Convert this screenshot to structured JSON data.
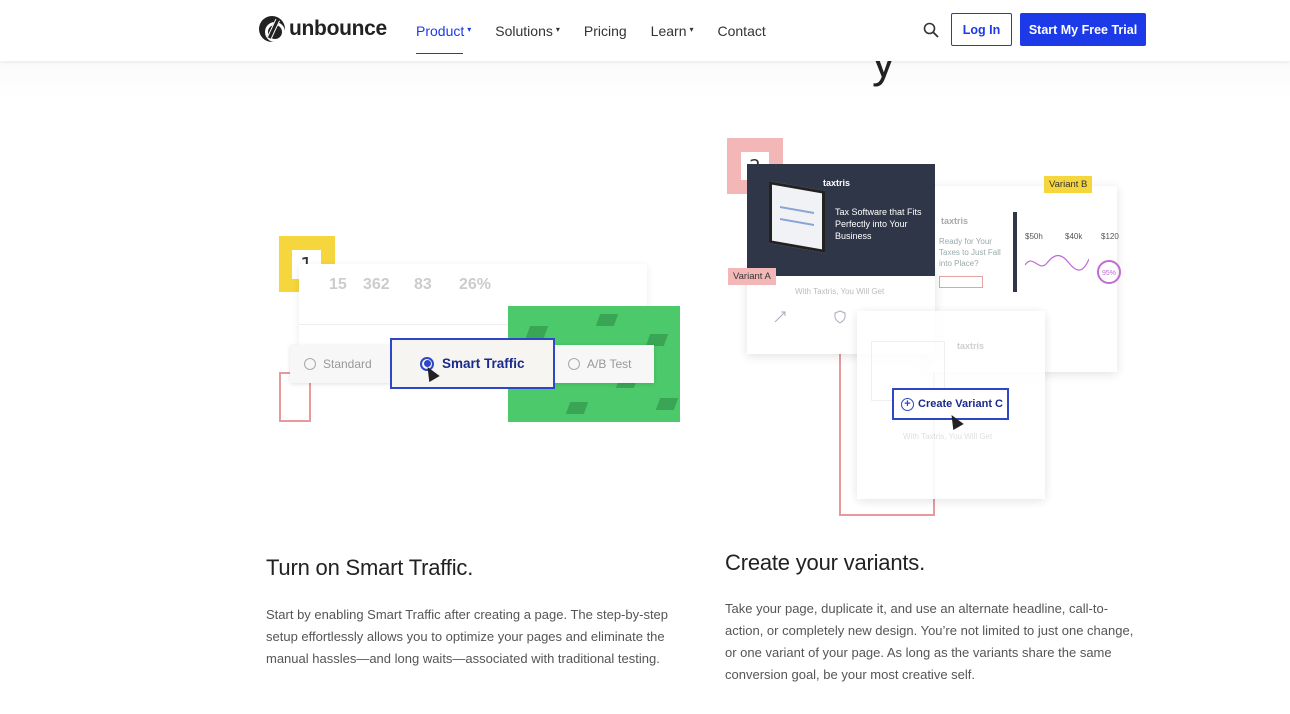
{
  "header": {
    "logo_text": "unbounce",
    "nav": [
      {
        "label": "Product",
        "has_dropdown": true,
        "active": true
      },
      {
        "label": "Solutions",
        "has_dropdown": true,
        "active": false
      },
      {
        "label": "Pricing",
        "has_dropdown": false,
        "active": false
      },
      {
        "label": "Learn",
        "has_dropdown": true,
        "active": false
      },
      {
        "label": "Contact",
        "has_dropdown": false,
        "active": false
      }
    ],
    "login_label": "Log In",
    "trial_label": "Start My Free Trial",
    "accent_color": "#1c3ae8",
    "icons": [
      "search-icon"
    ]
  },
  "step1": {
    "number": "1",
    "stats": [
      "15",
      "362",
      "83",
      "26%"
    ],
    "options": {
      "standard": "Standard",
      "smart_traffic": "Smart Traffic",
      "ab_test": "A/B Test"
    },
    "heading": "Turn on Smart Traffic.",
    "body": "Start by enabling Smart Traffic after creating a page. The step-by-step setup effortlessly allows you to optimize your pages and eliminate the manual hassles—and long waits—associated with traditional testing."
  },
  "step2": {
    "number": "2",
    "brand": "taxtris",
    "tagline": "Tax Software that Fits Perfectly into Your Business",
    "variant_a": "Variant A",
    "variant_b": "Variant B",
    "variant_b_headline": "Ready for Your Taxes to Just Fall into Place?",
    "subline": "With Taxtris, You Will Get",
    "metrics": [
      "$50h",
      "$40k",
      "$120"
    ],
    "percent": "95%",
    "create_variant": "Create Variant C",
    "heading": "Create your variants.",
    "body": "Take your page, duplicate it, and use an alternate headline, call-to-action, or completely new design. You’re not limited to just one change, or one variant of your page. As long as the variants share the same conversion goal, be your most creative self."
  }
}
